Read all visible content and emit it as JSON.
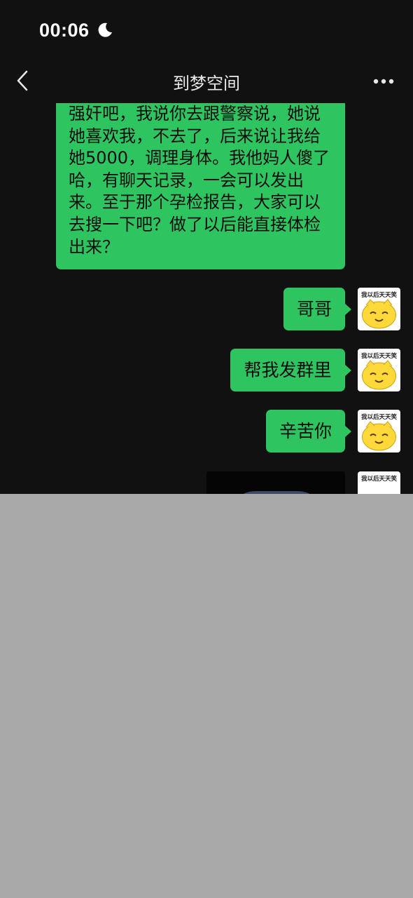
{
  "status_bar": {
    "time": "00:06"
  },
  "nav": {
    "title": "到梦空间"
  },
  "messages": {
    "long_text": "强奸吧，我说你去跟警察说，她说她喜欢我，不去了，后来说让我给她5000，调理身体。我他妈人傻了哈，有聊天记录，一会可以发出来。至于那个孕检报告，大家可以去搜一下吧？做了以后能直接体检出来？",
    "msg1": "哥哥",
    "msg2": "帮我发群里",
    "msg3": "辛苦你"
  },
  "avatar": {
    "caption": "我以后天天笑"
  },
  "colors": {
    "bubble": "#2ec560",
    "background": "#111111",
    "redacted": "#a8a8a8"
  }
}
